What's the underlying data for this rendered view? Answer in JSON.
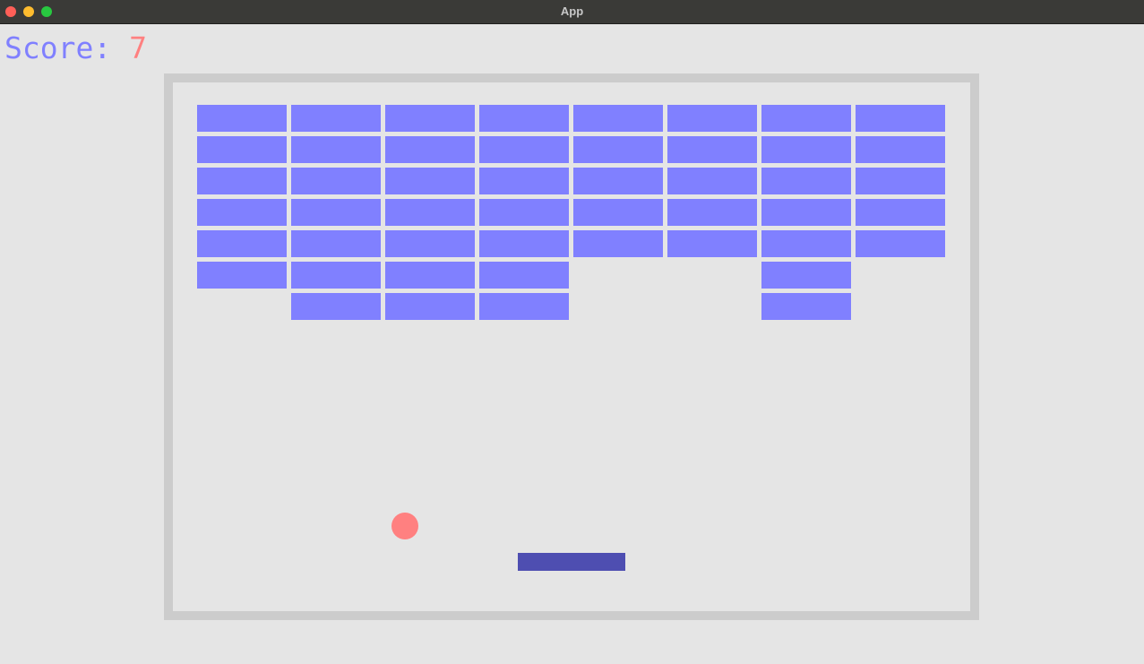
{
  "window": {
    "title": "App"
  },
  "hud": {
    "score_label": "Score: ",
    "score_value": "7"
  },
  "colors": {
    "brick": "#8080ff",
    "ball": "#ff8080",
    "paddle": "#4e4eb1",
    "wall": "#cccccc",
    "background": "#e5e5e5",
    "score_label": "#8080ff",
    "score_value": "#ff8080"
  },
  "bricks": {
    "columns": 8,
    "rows": 7,
    "present": [
      [
        1,
        1,
        1,
        1,
        1,
        1,
        1,
        1
      ],
      [
        1,
        1,
        1,
        1,
        1,
        1,
        1,
        1
      ],
      [
        1,
        1,
        1,
        1,
        1,
        1,
        1,
        1
      ],
      [
        1,
        1,
        1,
        1,
        1,
        1,
        1,
        1
      ],
      [
        1,
        1,
        1,
        1,
        1,
        1,
        1,
        1
      ],
      [
        1,
        1,
        1,
        1,
        0,
        0,
        1,
        0
      ],
      [
        0,
        1,
        1,
        1,
        0,
        0,
        1,
        0
      ]
    ]
  }
}
